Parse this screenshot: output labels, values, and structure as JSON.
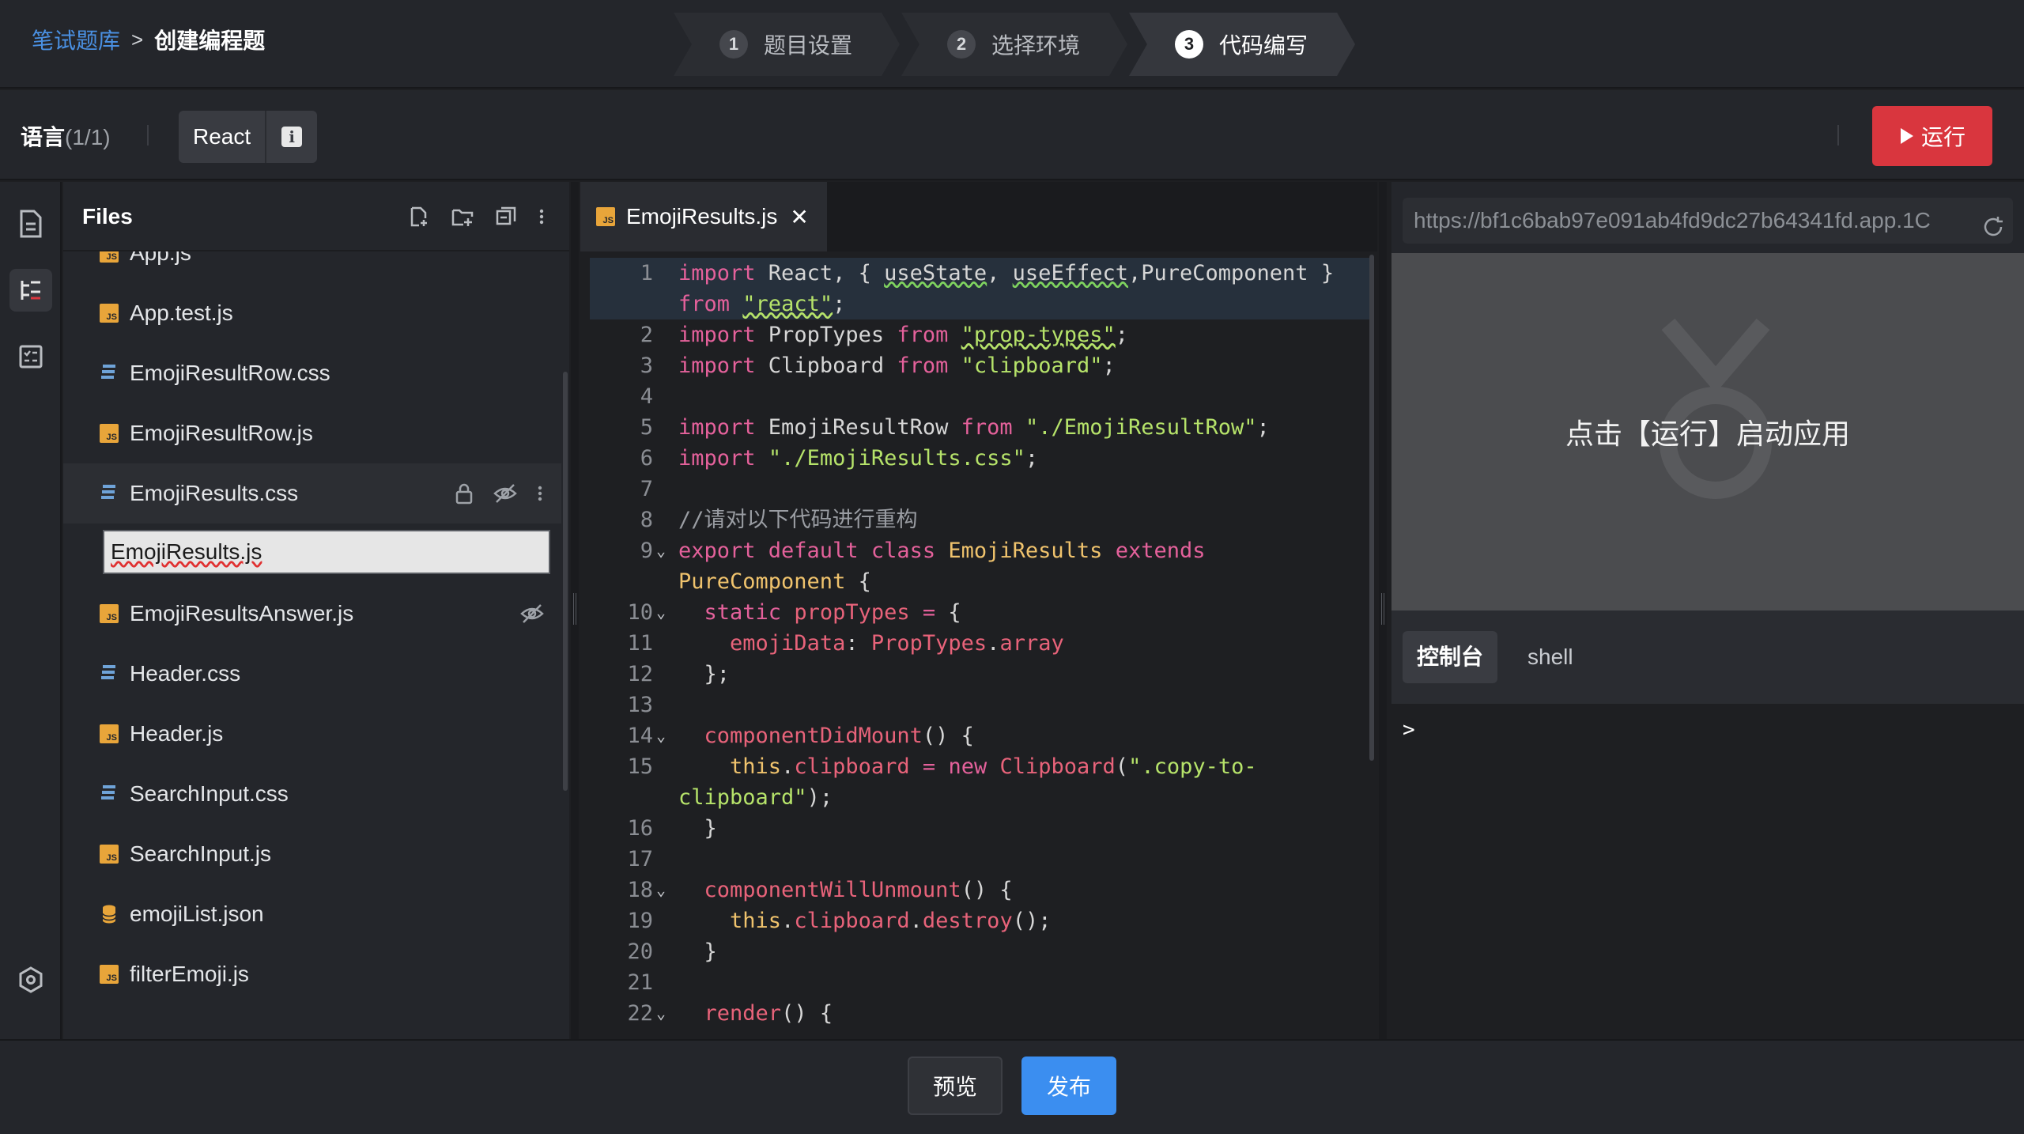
{
  "header": {
    "breadcrumb_root": "笔试题库",
    "breadcrumb_sep": ">",
    "breadcrumb_current": "创建编程题",
    "steps": [
      {
        "num": "1",
        "label": "题目设置"
      },
      {
        "num": "2",
        "label": "选择环境"
      },
      {
        "num": "3",
        "label": "代码编写"
      }
    ]
  },
  "toolbar": {
    "lang_label": "语言",
    "lang_count": "(1/1)",
    "lang_name": "React",
    "info_glyph": "i",
    "run_label": "运行"
  },
  "files": {
    "title": "Files",
    "items": [
      {
        "name": "App.js",
        "type": "js"
      },
      {
        "name": "App.test.js",
        "type": "js"
      },
      {
        "name": "EmojiResultRow.css",
        "type": "css"
      },
      {
        "name": "EmojiResultRow.js",
        "type": "js"
      },
      {
        "name": "EmojiResults.css",
        "type": "css"
      },
      {
        "name": "EmojiResults.js",
        "type": "js"
      },
      {
        "name": "EmojiResultsAnswer.js",
        "type": "js"
      },
      {
        "name": "Header.css",
        "type": "css"
      },
      {
        "name": "Header.js",
        "type": "js"
      },
      {
        "name": "SearchInput.css",
        "type": "css"
      },
      {
        "name": "SearchInput.js",
        "type": "js"
      },
      {
        "name": "emojiList.json",
        "type": "json"
      },
      {
        "name": "filterEmoji.js",
        "type": "js"
      }
    ]
  },
  "editor": {
    "tab_name": "EmojiResults.js",
    "tab_close": "✕",
    "icon_label": "JS",
    "line_numbers": [
      "1",
      "",
      "2",
      "3",
      "4",
      "5",
      "6",
      "7",
      "8",
      "9",
      "",
      "10",
      "11",
      "12",
      "13",
      "14",
      "15",
      "",
      "16",
      "17",
      "18",
      "19",
      "20",
      "21",
      "22"
    ]
  },
  "preview": {
    "url": "https://bf1c6bab97e091ab4fd9dc27b64341fd.app.1C",
    "placeholder": "点击【运行】启动应用",
    "tabs": [
      "控制台",
      "shell"
    ],
    "prompt": ">"
  },
  "footer": {
    "preview_label": "预览",
    "publish_label": "发布"
  },
  "colors": {
    "accent_blue": "#3b8ef0",
    "run_red": "#d9363e",
    "js_icon": "#e8a53a",
    "css_icon": "#6fa3d8"
  }
}
